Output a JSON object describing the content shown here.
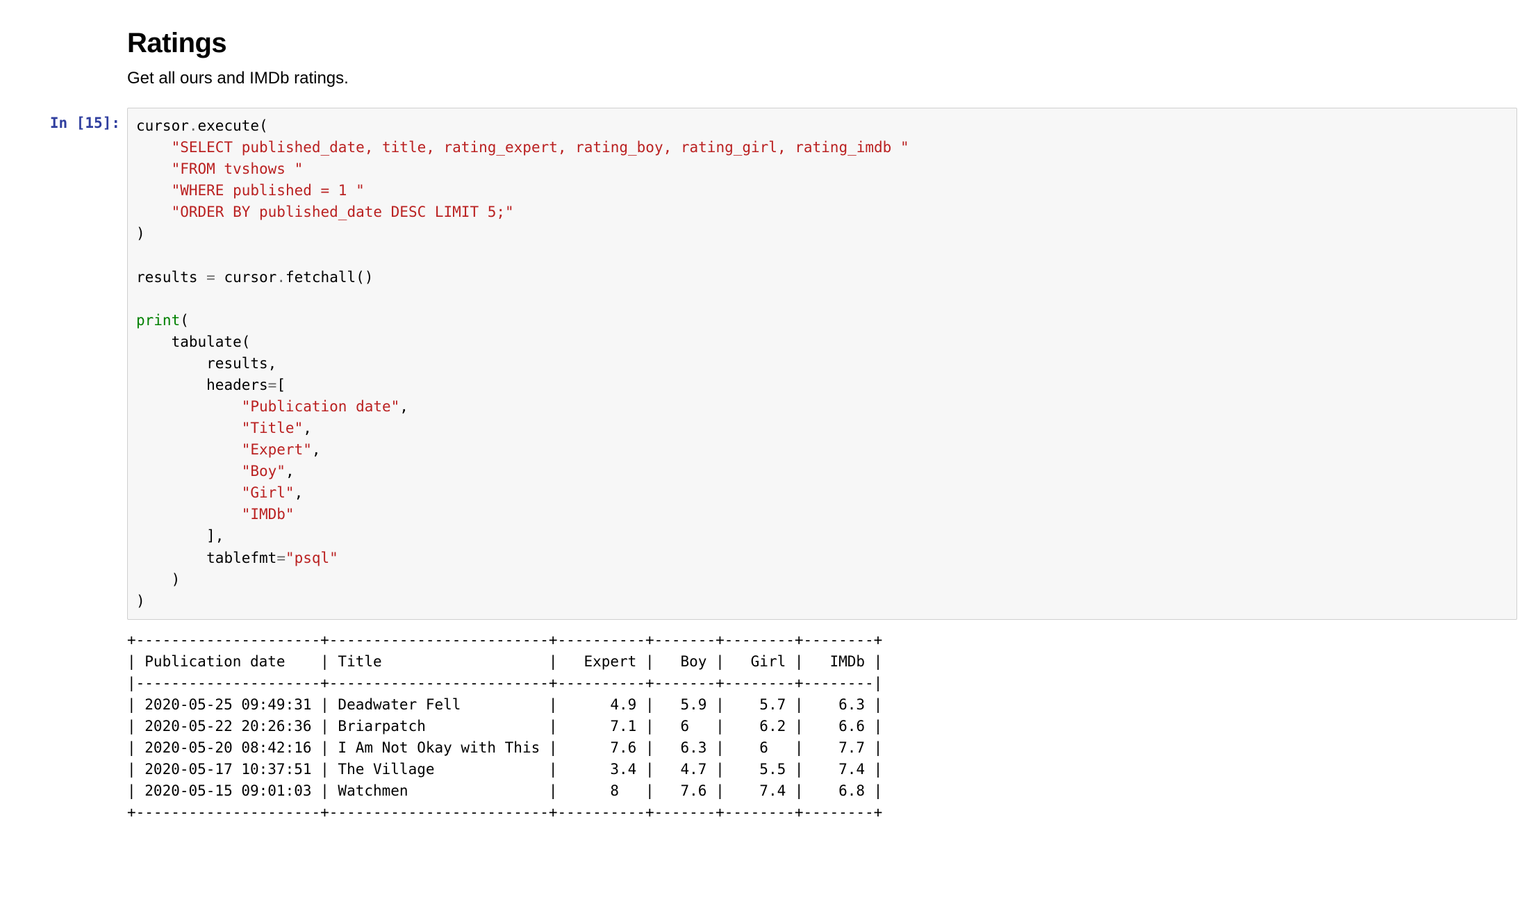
{
  "heading": "Ratings",
  "subtitle": "Get all ours and IMDb ratings.",
  "prompt_label": "In [15]:",
  "code": {
    "l01a": "cursor",
    "l01b": ".",
    "l01c": "execute",
    "l01d": "(",
    "l02": "\"SELECT published_date, title, rating_expert, rating_boy, rating_girl, rating_imdb \"",
    "l03": "\"FROM tvshows \"",
    "l04": "\"WHERE published = 1 \"",
    "l05": "\"ORDER BY published_date DESC LIMIT 5;\"",
    "l06": ")",
    "l08a": "results ",
    "l08b": "=",
    "l08c": " cursor",
    "l08d": ".",
    "l08e": "fetchall()",
    "l10a": "print",
    "l10b": "(",
    "l11a": "tabulate(",
    "l12": "results,",
    "l13a": "headers",
    "l13b": "=",
    "l13c": "[",
    "l14": "\"Publication date\"",
    "comma": ",",
    "l15": "\"Title\"",
    "l16": "\"Expert\"",
    "l17": "\"Boy\"",
    "l18": "\"Girl\"",
    "l19": "\"IMDb\"",
    "l20": "],",
    "l21a": "tablefmt",
    "l21b": "=",
    "l21c": "\"psql\"",
    "l22": ")",
    "l23": ")"
  },
  "output_lines": [
    "+---------------------+-------------------------+----------+-------+--------+--------+",
    "| Publication date    | Title                   |   Expert |   Boy |   Girl |   IMDb |",
    "|---------------------+-------------------------+----------+-------+--------+--------|",
    "| 2020-05-25 09:49:31 | Deadwater Fell          |      4.9 |   5.9 |    5.7 |    6.3 |",
    "| 2020-05-22 20:26:36 | Briarpatch              |      7.1 |   6   |    6.2 |    6.6 |",
    "| 2020-05-20 08:42:16 | I Am Not Okay with This |      7.6 |   6.3 |    6   |    7.7 |",
    "| 2020-05-17 10:37:51 | The Village             |      3.4 |   4.7 |    5.5 |    7.4 |",
    "| 2020-05-15 09:01:03 | Watchmen                |      8   |   7.6 |    7.4 |    6.8 |",
    "+---------------------+-------------------------+----------+-------+--------+--------+"
  ],
  "chart_data": {
    "type": "table",
    "title": "Ratings",
    "columns": [
      "Publication date",
      "Title",
      "Expert",
      "Boy",
      "Girl",
      "IMDb"
    ],
    "rows": [
      [
        "2020-05-25 09:49:31",
        "Deadwater Fell",
        4.9,
        5.9,
        5.7,
        6.3
      ],
      [
        "2020-05-22 20:26:36",
        "Briarpatch",
        7.1,
        6,
        6.2,
        6.6
      ],
      [
        "2020-05-20 08:42:16",
        "I Am Not Okay with This",
        7.6,
        6.3,
        6,
        7.7
      ],
      [
        "2020-05-17 10:37:51",
        "The Village",
        3.4,
        4.7,
        5.5,
        7.4
      ],
      [
        "2020-05-15 09:01:03",
        "Watchmen",
        8,
        7.6,
        7.4,
        6.8
      ]
    ]
  }
}
